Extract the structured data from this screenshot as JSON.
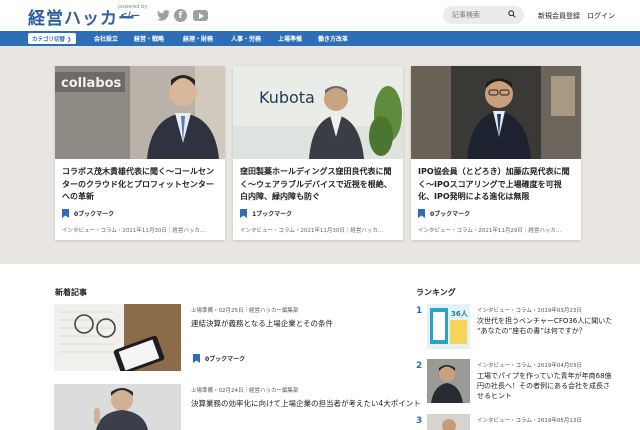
{
  "header": {
    "logo_text": "経営ハッカー",
    "logo_sub": "powered by",
    "logo_mark": "</—",
    "search_placeholder": "記事検索",
    "register_label": "新規会員登録",
    "login_label": "ログイン",
    "social": [
      "twitter-icon",
      "facebook-icon",
      "youtube-icon"
    ]
  },
  "nav": {
    "category_label": "カテゴリ切替 ❯",
    "items": [
      "会社設立",
      "経営・戦略",
      "経理・財務",
      "人事・労務",
      "上場準備",
      "働き方改革"
    ]
  },
  "features": [
    {
      "title": "コラボス茂木貴雄代表に聞く〜コールセンターのクラウド化とプロフィットセンターへの革新",
      "bookmark": "0ブックマーク",
      "meta": "インタビュー・コラム・2021年11月30日｜経営ハッカ…",
      "image_text": "collabos"
    },
    {
      "title": "窪田製薬ホールディングス窪田良代表に聞く〜ウェアラブルデバイスで近視を根絶、白内障、緑内障も防ぐ",
      "bookmark": "1ブックマーク",
      "meta": "インタビュー・コラム・2021年11月30日｜経営ハッカ…",
      "image_text": "Kubota"
    },
    {
      "title": "IPO協会員（とどろき）加藤広晃代表に聞く〜IPOスコアリングで上場確度を可視化、IPO発明による進化は無限",
      "bookmark": "0ブックマーク",
      "meta": "インタビュー・コラム・2021年11月29日｜経営ハッカ…",
      "image_text": ""
    }
  ],
  "news": {
    "title": "新着記事",
    "items": [
      {
        "meta": "上場準備・02月25日｜経営ハッカー編集部",
        "title": "連結決算が義務となる上場企業とその条件",
        "bookmark": "0ブックマーク"
      },
      {
        "meta": "上場準備・02月24日｜経営ハッカー編集部",
        "title": "決算業務の効率化に向けて上場企業の担当者が考えたい4大ポイント",
        "bookmark": ""
      }
    ]
  },
  "ranking": {
    "title": "ランキング",
    "items": [
      {
        "rank": "1",
        "meta": "インタビュー・コラム・2019年03月23日",
        "title": "次世代を担うベンチャーCFO36人に聞いた “あなたの”座右の書”は何ですか？",
        "thumb_text": "36人"
      },
      {
        "rank": "2",
        "meta": "インタビュー・コラム・2019年04月03日",
        "title": "工場でパイプを作っていた青年が年商68億円の社長へ！その者例にある会社を成長させるヒント",
        "thumb_text": ""
      },
      {
        "rank": "3",
        "meta": "インタビュー・コラム・2019年05月13日",
        "title": "",
        "thumb_text": ""
      }
    ]
  },
  "colors": {
    "brand": "#2e6eb8",
    "logo": "#2f5f9e",
    "feature_bg": "#e9e6e1"
  }
}
